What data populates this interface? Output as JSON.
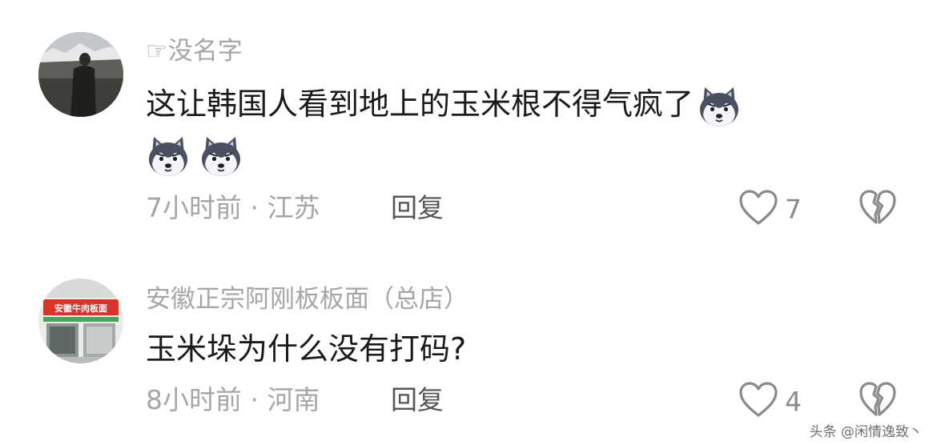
{
  "comments": [
    {
      "username": "☞没名字",
      "text": "这让韩国人看到地上的玉米根不得气疯了",
      "emoji_name": "husky-dog-emoji",
      "emoji_count": 3,
      "time_location": "7小时前 · 江苏",
      "reply_label": "回复",
      "like_count": "7",
      "avatar_icon": "avatar-landscape-person-icon"
    },
    {
      "username": "安徽正宗阿刚板板面（总店）",
      "text": "玉米垛为什么没有打码?",
      "time_location": "8小时前 · 河南",
      "reply_label": "回复",
      "like_count": "4",
      "avatar_icon": "avatar-shopfront-icon",
      "avatar_sign_text": "安徽牛肉板面"
    }
  ],
  "colors": {
    "secondary_text": "#a6a6a6",
    "primary_text": "#1a1a1a",
    "icon_stroke": "#8a8a8a"
  },
  "watermark": "头条 @闲情逸致丶"
}
